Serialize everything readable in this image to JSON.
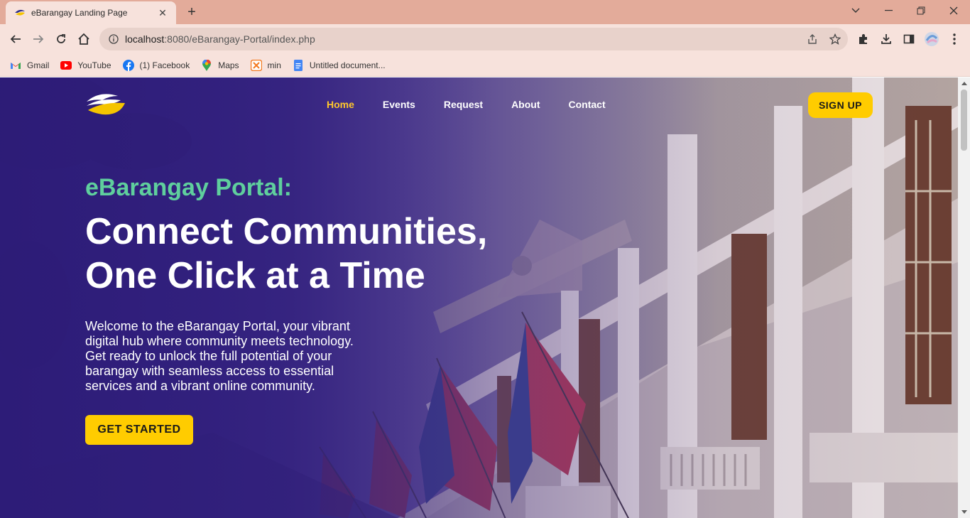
{
  "browser": {
    "tab_title": "eBarangay Landing Page",
    "url_host": "localhost",
    "url_rest": ":8080/eBarangay-Portal/index.php",
    "bookmarks": [
      {
        "label": "Gmail",
        "icon": "gmail-icon"
      },
      {
        "label": "YouTube",
        "icon": "youtube-icon"
      },
      {
        "label": "(1) Facebook",
        "icon": "facebook-icon"
      },
      {
        "label": "Maps",
        "icon": "maps-icon"
      },
      {
        "label": "min",
        "icon": "xampp-icon"
      },
      {
        "label": "Untitled document...",
        "icon": "docs-icon"
      }
    ]
  },
  "page": {
    "nav": [
      {
        "label": "Home",
        "active": true
      },
      {
        "label": "Events",
        "active": false
      },
      {
        "label": "Request",
        "active": false
      },
      {
        "label": "About",
        "active": false
      },
      {
        "label": "Contact",
        "active": false
      }
    ],
    "signup_label": "SIGN UP",
    "kicker": "eBarangay Portal:",
    "headline_line1": "Connect Communities,",
    "headline_line2": "One Click at a Time",
    "description": "Welcome to the eBarangay Portal, your vibrant digital hub where community meets technology. Get ready to unlock the full potential of your barangay with seamless access to essential services and a vibrant online community.",
    "cta_label": "GET STARTED"
  },
  "colors": {
    "accent_yellow": "#ffcc00",
    "kicker_green": "#5fcf9d",
    "hero_purple": "#2d1d78",
    "chrome_tab": "#e3ab9a"
  }
}
